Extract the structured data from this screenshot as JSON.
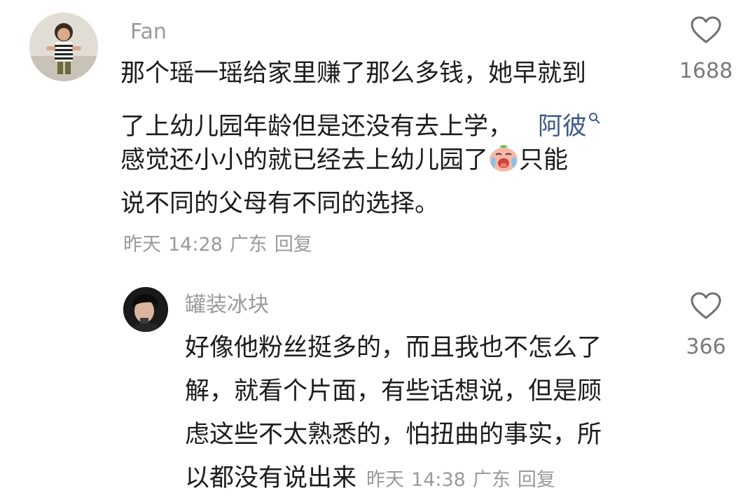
{
  "comments": [
    {
      "username": "Fan",
      "text_lines": [
        "那个瑶一瑶给家里赚了那么多钱，她早就到",
        "了上幼儿园年龄但是还没有去上学，",
        "感觉还小小的就已经去上幼儿园了",
        "只能",
        "说不同的父母有不同的选择。"
      ],
      "mention": "阿彼",
      "meta": {
        "date": "昨天",
        "time": "14:28",
        "location": "广东",
        "reply": "回复"
      },
      "likes": "1688"
    },
    {
      "username": "罐装冰块",
      "text_lines": [
        "好像他粉丝挺多的，而且我也不怎么了",
        "解，就看个片面，有些话想说，但是顾",
        "虑这些不太熟悉的，怕扭曲的事实，所",
        "以都没有说出来"
      ],
      "meta": {
        "date": "昨天",
        "time": "14:38",
        "location": "广东",
        "reply": "回复"
      },
      "likes": "366"
    }
  ],
  "icons": {
    "like": "heart-outline-icon",
    "emoji": "crying-face-emoji",
    "search": "search-icon"
  },
  "colors": {
    "text": "#1c1c1c",
    "secondary": "#9a9a9a",
    "mention": "#3d5a86"
  }
}
